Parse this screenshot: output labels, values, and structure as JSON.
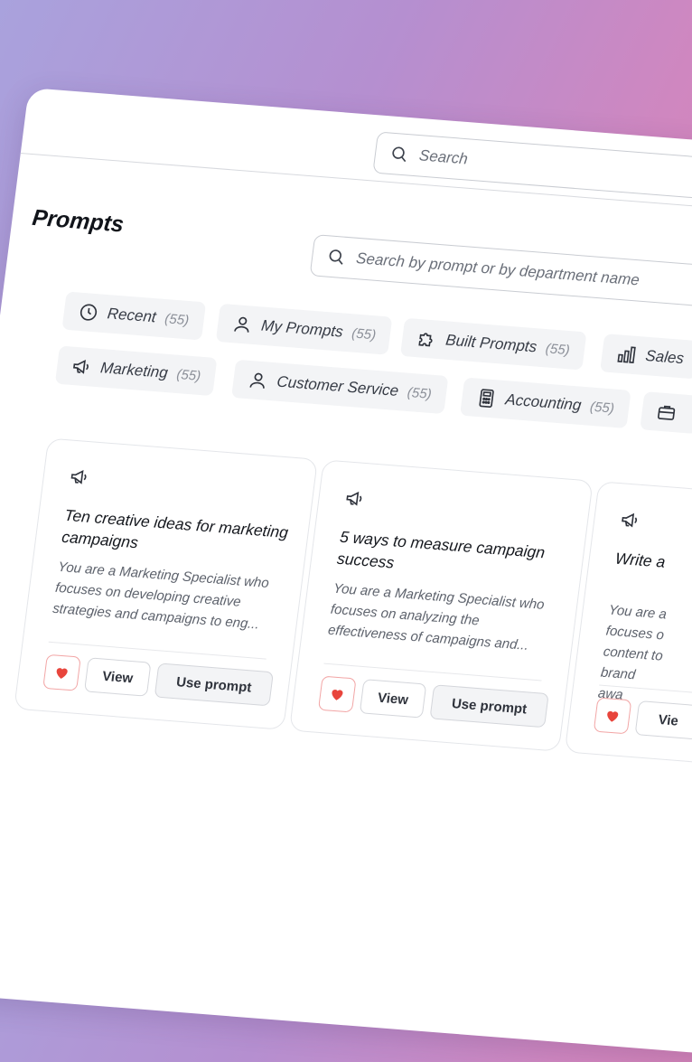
{
  "colors": {
    "heart": "#e8453c",
    "heart_border": "#f2a5a5",
    "chip_bg": "#f3f4f6",
    "text": "#2b2f38"
  },
  "header": {
    "search_placeholder": "Search"
  },
  "page": {
    "title": "Prompts",
    "search_placeholder": "Search by prompt or by department name"
  },
  "categories": [
    {
      "label": "Recent",
      "count": "(55)",
      "icon": "clock-icon"
    },
    {
      "label": "My Prompts",
      "count": "(55)",
      "icon": "user-icon"
    },
    {
      "label": "Built Prompts",
      "count": "(55)",
      "icon": "puzzle-icon"
    },
    {
      "label": "Sales",
      "count": "",
      "icon": "bar-chart-icon"
    },
    {
      "label": "Marketing",
      "count": "(55)",
      "icon": "megaphone-icon"
    },
    {
      "label": "Customer Service",
      "count": "(55)",
      "icon": "user-icon"
    },
    {
      "label": "Accounting",
      "count": "(55)",
      "icon": "calculator-icon"
    },
    {
      "label": "",
      "count": "",
      "icon": "briefcase-icon"
    }
  ],
  "cards": [
    {
      "title": "Ten creative ideas for marketing campaigns",
      "description": "You are a Marketing Specialist who focuses on developing creative strategies and campaigns to eng...",
      "view_label": "View",
      "use_label": "Use prompt",
      "icon": "megaphone-icon"
    },
    {
      "title": "5 ways to measure campaign success",
      "description": "You are a Marketing Specialist who focuses on analyzing the effectiveness of campaigns and...",
      "view_label": "View",
      "use_label": "Use prompt",
      "icon": "megaphone-icon"
    },
    {
      "title": "Write a",
      "description": "You are a focuses o content to brand awa",
      "view_label": "Vie",
      "use_label": "",
      "icon": "megaphone-icon"
    }
  ]
}
